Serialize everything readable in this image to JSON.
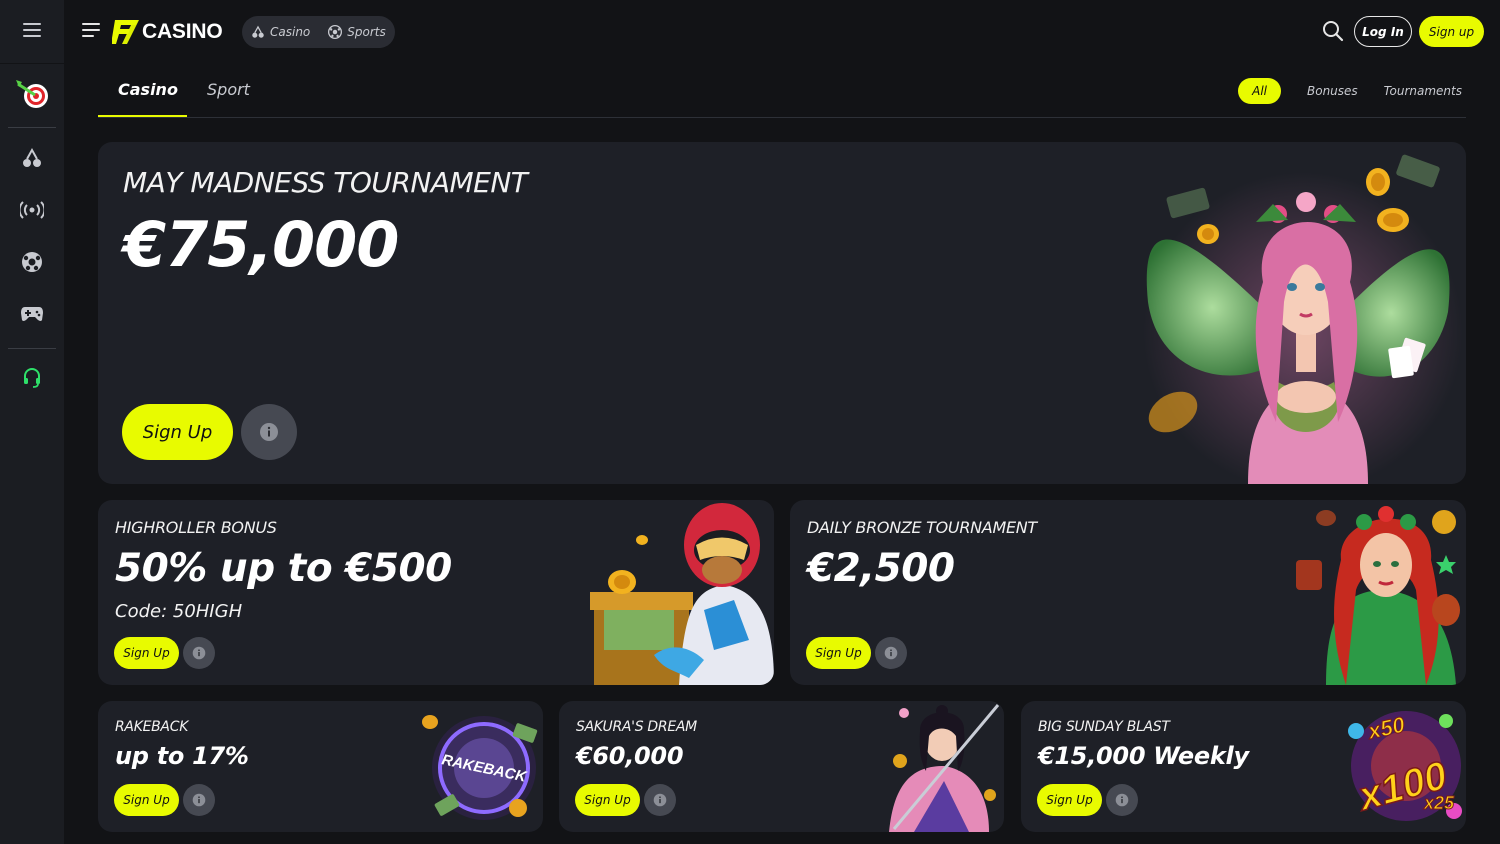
{
  "brand": {
    "logo_text": "CASINO",
    "accent": "#e8fb00"
  },
  "topbar": {
    "modes": [
      {
        "label": "Casino",
        "icon": "cherry-icon"
      },
      {
        "label": "Sports",
        "icon": "soccer-ball-icon"
      }
    ],
    "login_label": "Log In",
    "signup_label": "Sign up"
  },
  "tabs": {
    "items": [
      "Casino",
      "Sport"
    ],
    "active": "Casino",
    "filters": [
      "All",
      "Bonuses",
      "Tournaments"
    ],
    "active_filter": "All"
  },
  "sidebar": {
    "icons": [
      "menu-icon",
      "dart-target-icon",
      "cherry-icon",
      "live-broadcast-icon",
      "soccer-ball-icon",
      "gamepad-icon",
      "support-headset-icon"
    ]
  },
  "promos": {
    "hero": {
      "title": "MAY MADNESS TOURNAMENT",
      "amount": "€75,000",
      "button": "Sign Up"
    },
    "highroller": {
      "title": "HIGHROLLER BONUS",
      "amount": "50% up to €500",
      "code": "Code: 50HIGH",
      "button": "Sign Up"
    },
    "bronze": {
      "title": "DAILY BRONZE TOURNAMENT",
      "amount": "€2,500",
      "button": "Sign Up"
    },
    "rakeback": {
      "title": "RAKEBACK",
      "amount": "up to 17%",
      "button": "Sign Up",
      "badge_text": "RAKEBACK"
    },
    "sakura": {
      "title": "SAKURA'S DREAM",
      "amount": "€60,000",
      "button": "Sign Up"
    },
    "sunday": {
      "title": "BIG SUNDAY BLAST",
      "amount": "€15,000 Weekly",
      "button": "Sign Up",
      "multipliers": [
        "x50",
        "x100",
        "x25"
      ]
    }
  }
}
